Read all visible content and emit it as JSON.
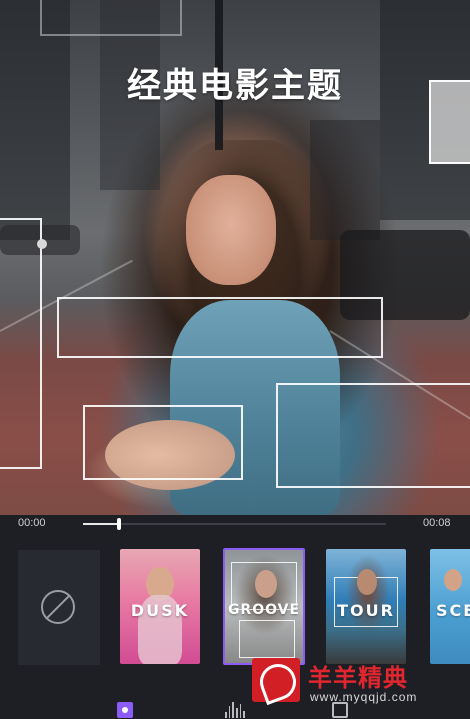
{
  "preview": {
    "title": "经典电影主题"
  },
  "timeline": {
    "current_time": "00:00",
    "total_time": "00:08",
    "progress": 0.12
  },
  "themes": {
    "items": [
      {
        "label": "DUSK",
        "selected": false
      },
      {
        "label": "GROOVE",
        "selected": true
      },
      {
        "label": "TOUR",
        "selected": false
      },
      {
        "label": "SCE",
        "selected": false
      }
    ]
  },
  "tabs": {
    "items": [
      {
        "icon": "film-theme-icon",
        "active": true
      },
      {
        "icon": "audio-waveform-icon",
        "active": false
      },
      {
        "icon": "adjust-icon",
        "active": false
      }
    ]
  },
  "watermark": {
    "brand": "羊羊精典",
    "url": "www.myqqjd.com"
  },
  "colors": {
    "accent": "#8b5cf6",
    "background": "#1e1f24",
    "watermark_red": "#d21f26"
  }
}
